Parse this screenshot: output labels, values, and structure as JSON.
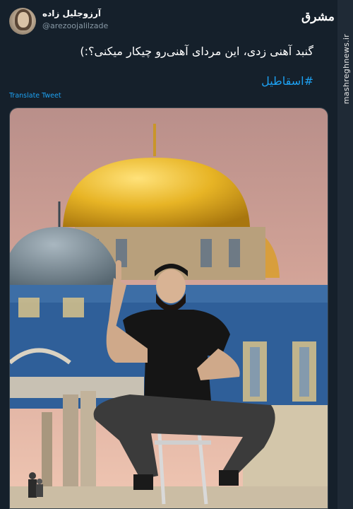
{
  "profile": {
    "display_name": "آرزوجلیل زاده",
    "handle": "@arezoojalilzade",
    "avatar_icon": "avatar-photo"
  },
  "brand": {
    "logo_text": "مشرق",
    "watermark": "mashreghnews.ir"
  },
  "tweet": {
    "text": "گنبد آهنی زدی، این مردای آهنی‌رو چیکار میکنی؟:)",
    "hashtag": "#اسقاطیل",
    "translate_label": "Translate Tweet"
  },
  "media": {
    "type": "photo",
    "icon": "photo-of-man-before-golden-dome"
  },
  "colors": {
    "background": "#15202b",
    "link": "#1da1f2",
    "muted": "#8899a6",
    "border": "#38444d"
  }
}
